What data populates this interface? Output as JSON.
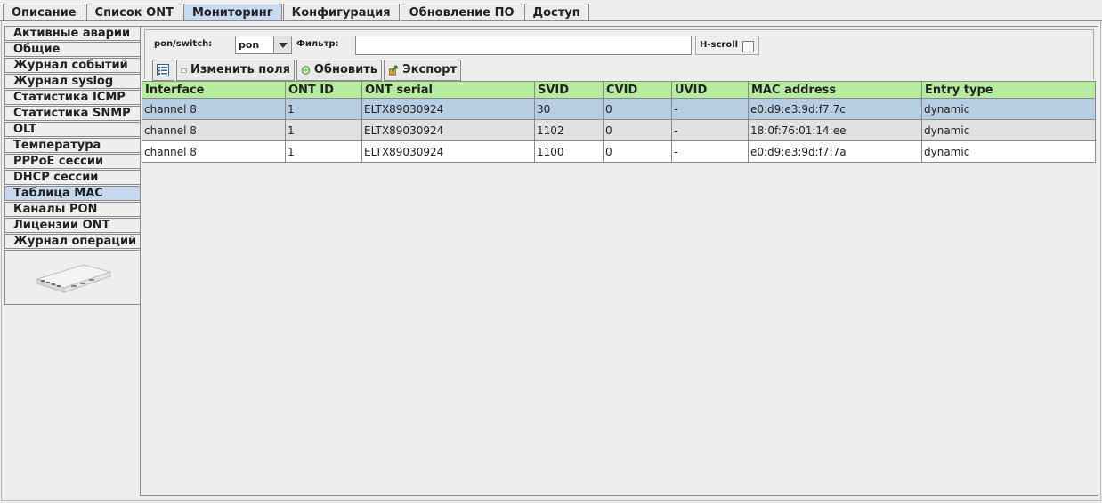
{
  "top_tabs": [
    {
      "label": "Описание",
      "active": false
    },
    {
      "label": "Список ONT",
      "active": false
    },
    {
      "label": "Мониторинг",
      "active": true
    },
    {
      "label": "Конфигурация",
      "active": false
    },
    {
      "label": "Обновление ПО",
      "active": false
    },
    {
      "label": "Доступ",
      "active": false
    }
  ],
  "sidebar": {
    "items": [
      {
        "label": "Активные аварии"
      },
      {
        "label": "Общие"
      },
      {
        "label": "Журнал событий"
      },
      {
        "label": "Журнал syslog"
      },
      {
        "label": "Статистика ICMP"
      },
      {
        "label": "Статистика SNMP"
      },
      {
        "label": "OLT"
      },
      {
        "label": "Температура"
      },
      {
        "label": "PPPoE сессии"
      },
      {
        "label": "DHCP сессии"
      },
      {
        "label": "Таблица MAC"
      },
      {
        "label": "Каналы PON"
      },
      {
        "label": "Лицензии ONT"
      },
      {
        "label": "Журнал операций"
      }
    ],
    "active_index": 10,
    "device_image": "olt-device-icon"
  },
  "toolbar": {
    "pon_switch_label": "pon/switch:",
    "pon_switch_value": "pon",
    "filter_label": "Фильтр:",
    "filter_value": "",
    "hscroll_label": "H-scroll",
    "hscroll_checked": false,
    "columns_icon": "columns-list-icon",
    "edit_fields_label": "Изменить поля",
    "refresh_label": "Обновить",
    "export_label": "Экспорт"
  },
  "table": {
    "columns": [
      "Interface",
      "ONT ID",
      "ONT serial",
      "SVID",
      "CVID",
      "UVID",
      "MAC address",
      "Entry type"
    ],
    "rows": [
      [
        "channel 8",
        "1",
        "ELTX89030924",
        "30",
        "0",
        "-",
        "e0:d9:e3:9d:f7:7c",
        "dynamic"
      ],
      [
        "channel 8",
        "1",
        "ELTX89030924",
        "1102",
        "0",
        "-",
        "18:0f:76:01:14:ee",
        "dynamic"
      ],
      [
        "channel 8",
        "1",
        "ELTX89030924",
        "1100",
        "0",
        "-",
        "e0:d9:e3:9d:f7:7a",
        "dynamic"
      ]
    ],
    "selected_row": 0
  },
  "colors": {
    "header_bg": "#b5ec9e",
    "selected_bg": "#b7cde2",
    "active_tab_bg": "#c9dcef"
  }
}
